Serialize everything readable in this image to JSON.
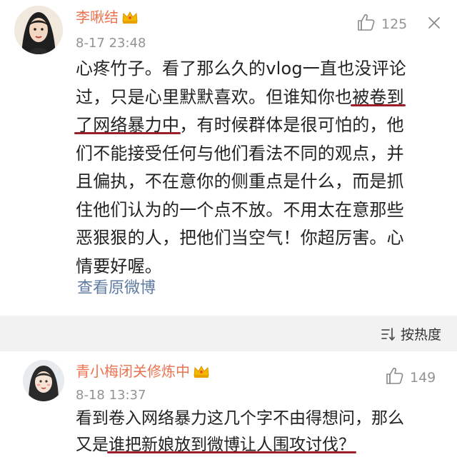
{
  "comments": [
    {
      "username": "李啾结",
      "time": "8-17 23:48",
      "likes": "125",
      "text_lines": [
        {
          "a": "心疼竹子。看了那么久的vlog一直也没评论"
        },
        {
          "a": "过，只是心里默默喜欢。但谁知你也",
          "hl": "被卷到"
        },
        {
          "hl": "了网络暴力中",
          "b": "，有时候群体是很可怕的，他"
        },
        {
          "a": "们不能接受任何与他们看法不同的观点，并"
        },
        {
          "a": "且偏执，不在意你的侧重点是什么，而是抓"
        },
        {
          "a": "住他们认为的一个点不放。不用太在意那些"
        },
        {
          "a": "恶狠狠的人，把他们当空气！你超厉害。心"
        },
        {
          "a": "情要好喔。"
        }
      ],
      "view_original": "查看原微博"
    },
    {
      "username": "青小梅闭关修炼中",
      "time": "8-18 13:37",
      "likes": "149",
      "text_lines": [
        {
          "a": "看到卷入网络暴力这几个字不由得想问，那么"
        },
        {
          "a": "又是",
          "hl": "谁把新娘放到微博让人围攻讨伐？"
        }
      ]
    }
  ],
  "sort_label": "按热度",
  "icons": {
    "like": "thumbs-up-icon",
    "more": "close-x-icon",
    "vip": "crown-icon",
    "sort": "sort-icon"
  },
  "colors": {
    "username": "#eb7350",
    "meta": "#939393",
    "link": "#5d7ba3",
    "underline": "#9c1e2a",
    "divider_bg": "#f2f2f2"
  }
}
